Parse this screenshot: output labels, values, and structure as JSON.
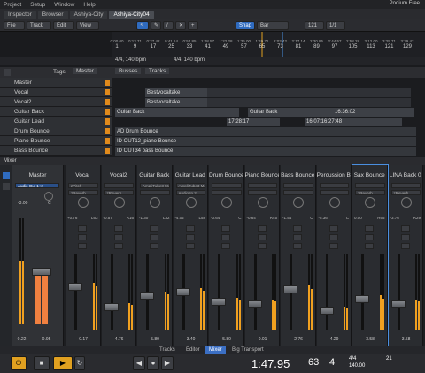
{
  "menu": [
    "Project",
    "Setup",
    "Window",
    "Help"
  ],
  "brand": "Podium Free",
  "tabs": [
    "Inspector",
    "Browser",
    "Ashiya-City",
    "Ashiya-City04"
  ],
  "toolbar": {
    "file": "File",
    "track": "Track",
    "edit": "Edit",
    "view": "View",
    "snap": "Snap",
    "bar": "Bar",
    "num1": "121",
    "num2": "1/1"
  },
  "ruler": {
    "times": [
      "0:00.00",
      "0:13.71",
      "0:27.42",
      "0:41.14",
      "0:54.85",
      "1:08.57",
      "1:22.28",
      "1:36.00",
      "1:49.71",
      "2:03.42",
      "2:17.14",
      "2:30.85",
      "2:44.57",
      "2:58.28",
      "3:12.00",
      "3:25.71",
      "3:39.42"
    ],
    "bars": [
      "1",
      "9",
      "17",
      "25",
      "33",
      "41",
      "49",
      "57",
      "65",
      "73",
      "81",
      "89",
      "97",
      "105",
      "113",
      "121",
      "129"
    ]
  },
  "tempo": {
    "t1": "4/4, 140 bpm",
    "t2": "4/4, 140 bpm"
  },
  "trackhdr": {
    "tags": "Tags:",
    "master": "Master",
    "busses": "Busses",
    "tracks": "Tracks"
  },
  "tracks": [
    "Master",
    "Vocal",
    "Vocal2",
    "Guitar Back",
    "Guitar Lead",
    "Drum Bounce",
    "Piano Bounce",
    "Bass Bounce"
  ],
  "clips": {
    "c1": "Bestvocaltake",
    "c2": "Bestvocaltake",
    "c3": "Guitar Back",
    "c4": "Guitar Back",
    "c5": "16:36:02",
    "c6": "17:28:17",
    "c7": "16:07:16:27:48",
    "c8": "AD Drum Bounce",
    "c9": "ID OUT12_piano Bounce",
    "c10": "ID OUT34 bass Bounce"
  },
  "mixer_label": "Mixer",
  "master": {
    "name": "Master",
    "io": "Audio Out 1+2",
    "val": "-3.00",
    "pan": "C",
    "l": "-0.22",
    "r": "-0.95"
  },
  "strips": [
    {
      "name": "Vocal",
      "ins": "zPitch",
      "send": "zReverb",
      "vol": "+0.76",
      "pan": "L63",
      "bot": "-0.17",
      "lvl": 0.62
    },
    {
      "name": "Vocal2",
      "ins": "",
      "send": "zReverb",
      "vol": "-0.57",
      "pan": "R16",
      "bot": "-4.76",
      "lvl": 0.35
    },
    {
      "name": "Guitar Back",
      "ins": "AmpliTube3 Mo",
      "send": "",
      "vol": "-1.30",
      "pan": "L32",
      "bot": "-5.80",
      "lvl": 0.5
    },
    {
      "name": "Guitar Lead",
      "ins": "AmpliTube3 Mo",
      "send": "Audio In 2",
      "vol": "-4.02",
      "pan": "L58",
      "bot": "-3.40",
      "lvl": 0.55
    },
    {
      "name": "Drum Bounce",
      "ins": "",
      "send": "",
      "vol": "-0.64",
      "pan": "C",
      "bot": "-5.80",
      "lvl": 0.42
    },
    {
      "name": "Piano Bounce",
      "ins": "",
      "send": "",
      "vol": "-0.64",
      "pan": "R45",
      "bot": "-0.01",
      "lvl": 0.4
    },
    {
      "name": "Bass Bounce",
      "ins": "",
      "send": "",
      "vol": "-1.54",
      "pan": "C",
      "bot": "-2.76",
      "lvl": 0.58
    },
    {
      "name": "Percussion B",
      "ins": "",
      "send": "",
      "vol": "-5.36",
      "pan": "C",
      "bot": "-4.29",
      "lvl": 0.3
    },
    {
      "name": "Sax Bounce",
      "ins": "",
      "send": "zReverb",
      "vol": "0.00",
      "pan": "R65",
      "bot": "-3.58",
      "lvl": 0.45
    },
    {
      "name": "LINA Back 0",
      "ins": "",
      "send": "zReverb",
      "vol": "-3.76",
      "pan": "R29",
      "bot": "-3.58",
      "lvl": 0.4
    }
  ],
  "bottom_tabs": [
    "Tracks",
    "Editor",
    "Mixer",
    "Big Transport"
  ],
  "transport": {
    "time": "1:47.95",
    "bar": "63",
    "beat": "4",
    "sig": "4/4",
    "bpm": "140.00",
    "right": "21"
  },
  "colors": {
    "accent": "#3b6fc4",
    "meter": "#f0a020",
    "clip": "#5a5d63"
  }
}
